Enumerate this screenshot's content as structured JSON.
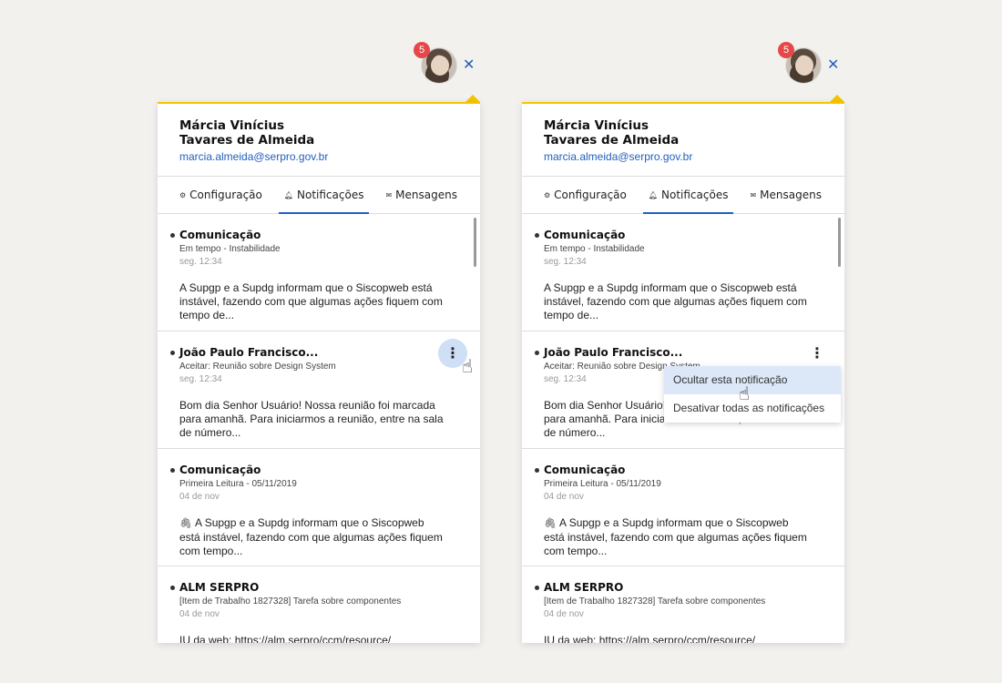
{
  "badge_count": "5",
  "user": {
    "name_line1": "Márcia Vinícius",
    "name_line2": "Tavares de Almeida",
    "email": "marcia.almeida@serpro.gov.br"
  },
  "tabs": [
    {
      "label": "Configuração",
      "icon": "gear-icon"
    },
    {
      "label": "Notificações",
      "icon": "bell-icon",
      "active": true
    },
    {
      "label": "Mensagens",
      "icon": "envelope-icon"
    }
  ],
  "notifications": [
    {
      "title": "Comunicação",
      "subtitle": "Em tempo - Instabilidade",
      "time": "seg. 12:34",
      "body": "A Supgp e a Supdg informam que o Siscopweb está instável, fazendo com que algumas ações fiquem com tempo de..."
    },
    {
      "title": "João Paulo Francisco...",
      "subtitle": "Aceitar: Reunião sobre Design System",
      "time": "seg. 12:34",
      "body": "Bom dia Senhor Usuário!  Nossa reunião foi marcada para amanhã. Para iniciarmos a reunião, entre na sala de número..."
    },
    {
      "title": "Comunicação",
      "subtitle": "Primeira Leitura - 05/11/2019",
      "time": "04 de nov",
      "body": "A Supgp e a Supdg informam que o Siscopweb está instável, fazendo com que algumas ações fiquem com tempo..."
    },
    {
      "title": "ALM SERPRO",
      "subtitle": "[Item de Trabalho 1827328] Tarefa sobre componentes",
      "time": "04 de nov",
      "body": "IU da web: https://alm.serpro/ccm/resource/"
    }
  ],
  "context_menu": {
    "hide": "Ocultar esta notificação",
    "disable_all": "Desativar todas as notificações"
  },
  "colors": {
    "accent": "#1f5fbf",
    "top_border": "#f5c400",
    "badge": "#e54848",
    "hover": "#cfdff5"
  }
}
